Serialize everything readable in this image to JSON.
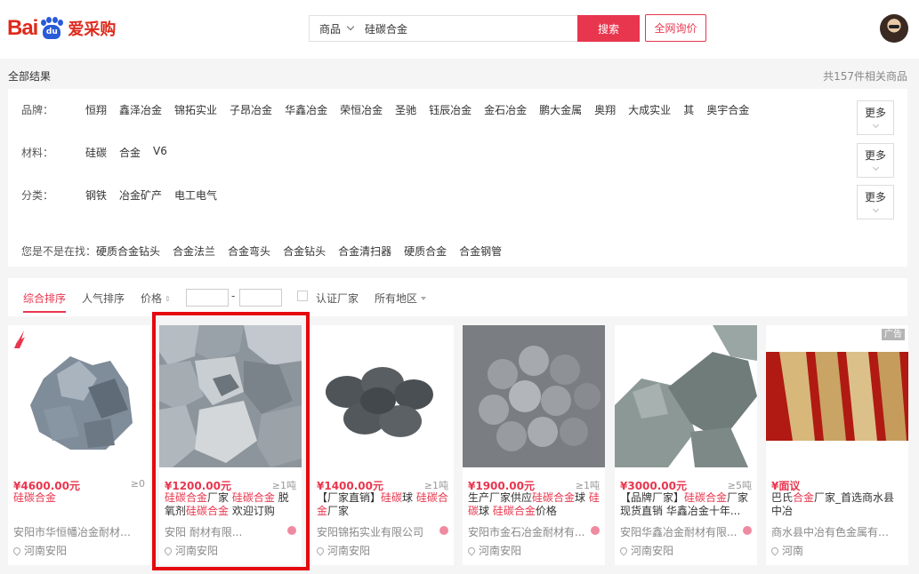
{
  "header": {
    "logo_bai": "Bai",
    "logo_du": "du",
    "logo_cn": "爱采购",
    "search_category": "商品",
    "search_value": "硅碳合金",
    "search_button": "搜索",
    "inquiry_button": "全网询价"
  },
  "results": {
    "left": "全部结果",
    "right": "共157件相关商品"
  },
  "filters": {
    "brand": {
      "label": "品牌：",
      "items": [
        "恒翔",
        "鑫泽冶金",
        "锦拓实业",
        "子昂冶金",
        "华鑫冶金",
        "荣恒冶金",
        "圣驰",
        "钰辰冶金",
        "金石冶金",
        "鹏大金属",
        "奥翔",
        "大成实业",
        "其",
        "奥宇合金"
      ],
      "more": "更多"
    },
    "material": {
      "label": "材料：",
      "items": [
        "硅碳",
        "合金",
        "V6"
      ],
      "more": "更多"
    },
    "category": {
      "label": "分类：",
      "items": [
        "钢铁",
        "冶金矿产",
        "电工电气"
      ],
      "more": "更多"
    },
    "suggest": {
      "label": "您是不是在找：",
      "items": [
        "硬质合金钻头",
        "合金法兰",
        "合金弯头",
        "合金钻头",
        "合金清扫器",
        "硬质合金",
        "合金钢管"
      ]
    }
  },
  "sortbar": {
    "comprehensive": "综合排序",
    "popularity": "人气排序",
    "price": "价格",
    "price_arrow": "⇕",
    "price_dash": "-",
    "certified": "认证厂家",
    "region": "所有地区"
  },
  "products": [
    {
      "price": "¥4600.00元",
      "moq": "≥0",
      "title_parts": [
        {
          "t": "硅碳合金",
          "hl": true
        }
      ],
      "company": "安阳市华恒幡冶金耐材有...",
      "location": "河南安阳",
      "badge": false
    },
    {
      "price": "¥1200.00元",
      "moq": "≥1吨",
      "title_parts": [
        {
          "t": "硅碳合金",
          "hl": true
        },
        {
          "t": "厂家 ",
          "hl": false
        },
        {
          "t": "硅碳合金",
          "hl": true
        },
        {
          "t": " 脱氧剂",
          "hl": false
        },
        {
          "t": "硅碳合金",
          "hl": true
        },
        {
          "t": " 欢迎订购",
          "hl": false
        }
      ],
      "company": "安阳 耐材有限...",
      "location": "河南安阳",
      "badge": true
    },
    {
      "price": "¥1400.00元",
      "moq": "≥1吨",
      "title_parts": [
        {
          "t": "【厂家直销】",
          "hl": false
        },
        {
          "t": "硅碳",
          "hl": true
        },
        {
          "t": "球 ",
          "hl": false
        },
        {
          "t": "硅碳合金",
          "hl": true
        },
        {
          "t": "厂家",
          "hl": false
        }
      ],
      "company": "安阳锦拓实业有限公司",
      "location": "河南安阳",
      "badge": true
    },
    {
      "price": "¥1900.00元",
      "moq": "≥1吨",
      "title_parts": [
        {
          "t": "生产厂家供应",
          "hl": false
        },
        {
          "t": "硅碳合金",
          "hl": true
        },
        {
          "t": "球 ",
          "hl": false
        },
        {
          "t": "硅碳",
          "hl": true
        },
        {
          "t": "球 ",
          "hl": false
        },
        {
          "t": "硅碳合金",
          "hl": true
        },
        {
          "t": "价格",
          "hl": false
        }
      ],
      "company": "安阳市金石冶金耐材有...",
      "location": "河南安阳",
      "badge": true
    },
    {
      "price": "¥3000.00元",
      "moq": "≥5吨",
      "title_parts": [
        {
          "t": "【品牌厂家】",
          "hl": false
        },
        {
          "t": "硅碳合金",
          "hl": true
        },
        {
          "t": "厂家 现货直销 华鑫冶金十年...",
          "hl": false
        }
      ],
      "company": "安阳华鑫冶金耐材有限...",
      "location": "河南安阳",
      "badge": true
    },
    {
      "price": "¥面议",
      "moq": "",
      "title_parts": [
        {
          "t": "巴氏",
          "hl": false
        },
        {
          "t": "合金",
          "hl": true
        },
        {
          "t": "厂家_首选商水县中冶",
          "hl": false
        }
      ],
      "company": "商水县中冶有色金属有限...",
      "location": "河南",
      "badge": false,
      "ad": "广告"
    }
  ]
}
